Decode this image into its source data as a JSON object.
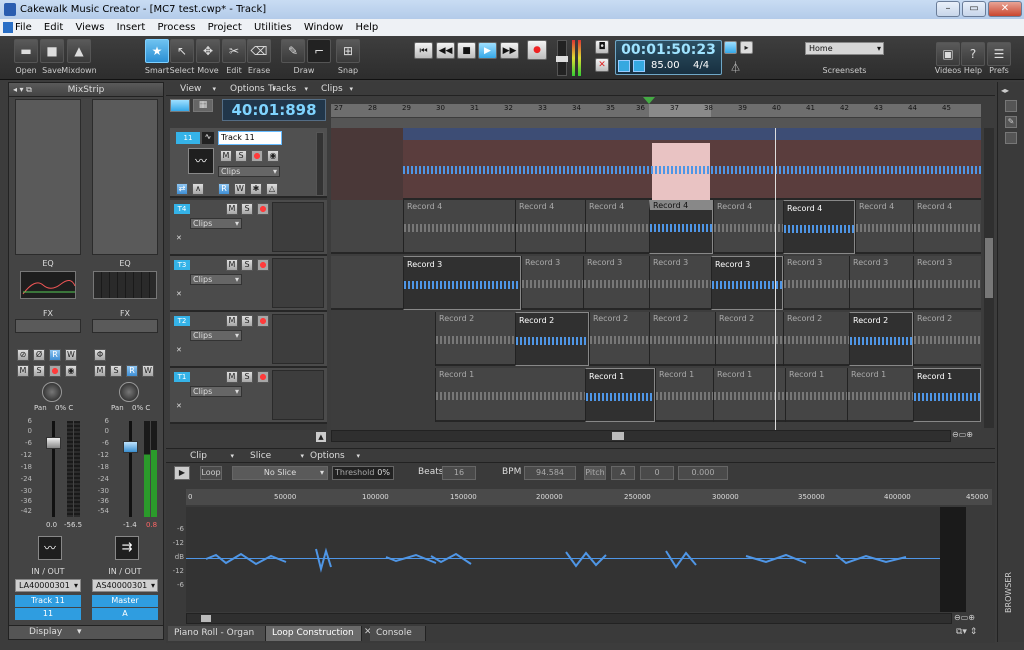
{
  "window": {
    "title": "Cakewalk Music Creator - [MC7 test.cwp* - Track]"
  },
  "menu": [
    "File",
    "Edit",
    "Views",
    "Insert",
    "Process",
    "Project",
    "Utilities",
    "Window",
    "Help"
  ],
  "toolbar": {
    "file_tools": [
      "Open",
      "Save",
      "Mixdown"
    ],
    "edit_tools": [
      "Smart",
      "Select",
      "Move",
      "Edit",
      "Erase",
      "Draw",
      "Snap"
    ],
    "time": "00:01:50:23",
    "tempo": "85.00",
    "meter": "4/4",
    "screenset_label": "Screensets",
    "screenset_value": "Home",
    "right_tools": [
      "Videos",
      "Help",
      "Prefs"
    ]
  },
  "mixstrip": {
    "title": "MixStrip",
    "eq_label": "EQ",
    "fx_label": "FX",
    "pan_label": "Pan",
    "pan_value": "0% C",
    "scale": [
      "6",
      "0",
      "-6",
      "-12",
      "-18",
      "-24",
      "-30",
      "-36",
      "-42",
      "-54"
    ],
    "io_label": "IN / OUT",
    "strips": [
      {
        "level": "0.0",
        "peak": "-56.5",
        "input": "LA40000301",
        "name": "Track 11",
        "num": "11",
        "record_armed": true
      },
      {
        "level": "-1.4",
        "peak": "0.8",
        "input": "AS40000301",
        "name": "Master",
        "num": "A",
        "record_armed": false
      }
    ],
    "display_label": "Display"
  },
  "track_view": {
    "menus": [
      "View",
      "Options",
      "Tracks",
      "Clips"
    ],
    "now_time": "40:01:898",
    "ruler": [
      "27",
      "28",
      "29",
      "30",
      "31",
      "32",
      "33",
      "34",
      "35",
      "36",
      "37",
      "38",
      "39",
      "40",
      "41",
      "42",
      "43",
      "44",
      "45"
    ],
    "tracks": [
      {
        "num": "11",
        "name": "Track 11",
        "clips_label": "Clips"
      },
      {
        "num": "T4",
        "name": "",
        "clips_label": "Clips"
      },
      {
        "num": "T3",
        "name": "",
        "clips_label": "Clips"
      },
      {
        "num": "T2",
        "name": "",
        "clips_label": "Clips"
      },
      {
        "num": "T1",
        "name": "",
        "clips_label": "Clips"
      }
    ],
    "lanes": [
      {
        "clips": []
      },
      {
        "clips": [
          "Record 4",
          "Record 4",
          "Record 4",
          "Record 4",
          "Record 4",
          "Record 4",
          "Record 4",
          "Record 4"
        ]
      },
      {
        "clips": [
          "Record 3",
          "Record 3",
          "Record 3",
          "Record 3",
          "Record 3",
          "Record 3",
          "Record 3",
          "Record 3"
        ]
      },
      {
        "clips": [
          "Record 2",
          "Record 2",
          "Record 2",
          "Record 2",
          "Record 2",
          "Record 2",
          "Record 2",
          "Record 2"
        ]
      },
      {
        "clips": [
          "Record 1",
          "Record 1",
          "Record 1",
          "Record 1",
          "Record 1",
          "Record 1",
          "Record 1",
          "Record 1"
        ]
      }
    ],
    "button_labels": {
      "mute": "M",
      "solo": "S",
      "read": "R"
    }
  },
  "loop": {
    "menus": [
      "Clip",
      "Slice",
      "Options"
    ],
    "loop_label": "Loop",
    "slice_value": "No Slice",
    "threshold_label": "Threshold",
    "threshold_value": "0%",
    "beats_label": "Beats",
    "beats_value": "16",
    "bpm_label": "BPM",
    "bpm_value": "94.584",
    "pitch_label": "Pitch",
    "pitch_a": "A",
    "pitch_b": "0",
    "pitch_c": "0.000",
    "ruler": [
      "0",
      "50000",
      "100000",
      "150000",
      "200000",
      "250000",
      "300000",
      "350000",
      "400000",
      "45000"
    ],
    "db_scale": [
      "-6",
      "-12",
      "dB",
      "-12",
      "-6"
    ]
  },
  "bottom_tabs": [
    "Piano Roll - Organ",
    "Loop Construction",
    "Console"
  ],
  "browser_label": "BROWSER"
}
